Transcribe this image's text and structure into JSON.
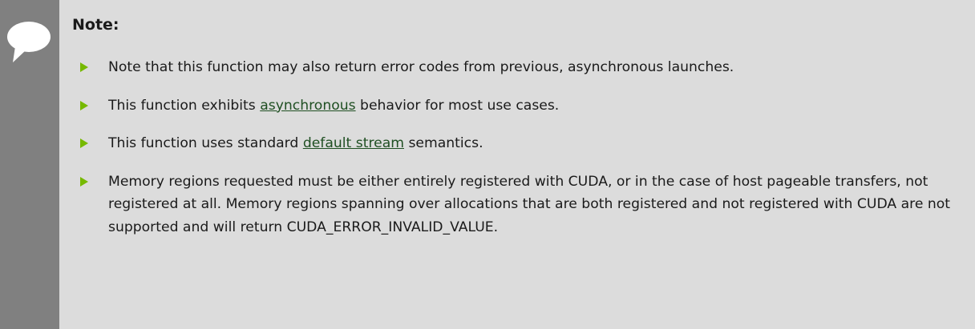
{
  "note": {
    "title": "Note:",
    "icon": "speech-bubble-icon",
    "colors": {
      "background": "#dcdcdc",
      "side_bar": "#808080",
      "bullet": "#76b900",
      "link": "#1f4f22"
    },
    "items": [
      {
        "text": "Note that this function may also return error codes from previous, asynchronous launches."
      },
      {
        "before": "This function exhibits ",
        "link": "asynchronous",
        "after": " behavior for most use cases."
      },
      {
        "before": "This function uses standard ",
        "link": "default stream",
        "after": " semantics."
      },
      {
        "text": "Memory regions requested must be either entirely registered with CUDA, or in the case of host pageable transfers, not registered at all. Memory regions spanning over allocations that are both registered and not registered with CUDA are not supported and will return CUDA_ERROR_INVALID_VALUE."
      }
    ]
  }
}
